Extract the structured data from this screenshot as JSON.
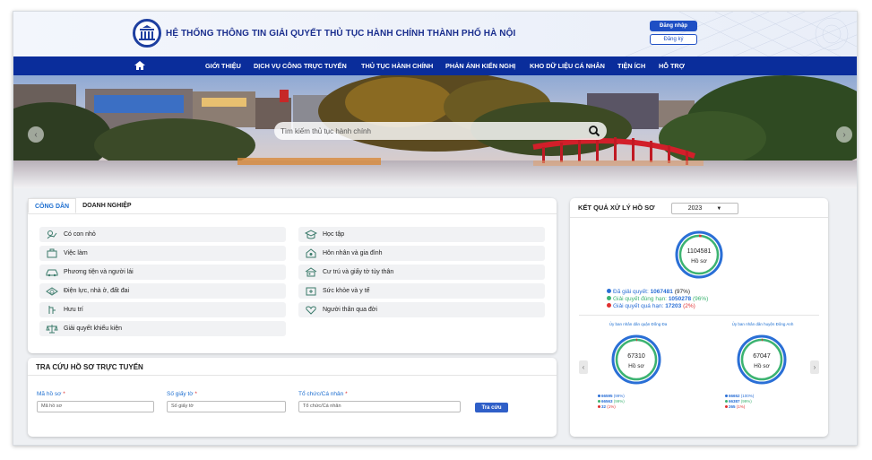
{
  "header": {
    "title": "HỆ THỐNG THÔNG TIN GIẢI QUYẾT THỦ TỤC HÀNH CHÍNH THÀNH PHỐ HÀ NỘI",
    "login_label": "Đăng nhập",
    "register_label": "Đăng ký"
  },
  "nav": {
    "items": [
      "GIỚI THIỆU",
      "DỊCH VỤ CÔNG TRỰC TUYẾN",
      "THỦ TỤC HÀNH CHÍNH",
      "PHẢN ÁNH KIẾN NGHỊ",
      "KHO DỮ LIỆU CÁ NHÂN",
      "TIỆN ÍCH",
      "HỖ TRỢ"
    ]
  },
  "banner": {
    "search_placeholder": "Tìm kiếm thủ tục hành chính"
  },
  "services": {
    "tabs": [
      "CÔNG DÂN",
      "DOANH NGHIỆP"
    ],
    "left": [
      {
        "label": "Có con nhỏ",
        "icon": "baby-icon"
      },
      {
        "label": "Việc làm",
        "icon": "briefcase-icon"
      },
      {
        "label": "Phương tiện và người lái",
        "icon": "car-icon"
      },
      {
        "label": "Điện lực, nhà ở, đất đai",
        "icon": "land-icon"
      },
      {
        "label": "Hưu trí",
        "icon": "retire-icon"
      },
      {
        "label": "Giải quyết khiếu kiện",
        "icon": "scale-icon"
      }
    ],
    "right": [
      {
        "label": "Học tập",
        "icon": "graduation-icon"
      },
      {
        "label": "Hôn nhân và gia đình",
        "icon": "family-icon"
      },
      {
        "label": "Cư trú và giấy tờ tùy thân",
        "icon": "id-card-icon"
      },
      {
        "label": "Sức khỏe và y tế",
        "icon": "health-icon"
      },
      {
        "label": "Người thân qua đời",
        "icon": "heart-icon"
      }
    ]
  },
  "lookup": {
    "title": "TRA CỨU HỒ SƠ TRỰC TUYẾN",
    "field1_label": "Mã hồ sơ",
    "field1_placeholder": "Mã hồ sơ",
    "field2_label": "Số giấy tờ",
    "field2_placeholder": "Số giấy tờ",
    "field3_label": "Tổ chức/Cá nhân",
    "field3_placeholder": "Tổ chức/Cá nhân",
    "required_mark": "*",
    "button_label": "Tra cứu"
  },
  "results": {
    "title": "KẾT QUẢ XỬ LÝ HỒ SƠ",
    "year": "2023",
    "total": "1104581",
    "unit": "Hồ sơ",
    "legend": [
      {
        "label": "Đã giải quyết:",
        "value": "1067481",
        "pct": "(97%)",
        "color": "#2a6fd6"
      },
      {
        "label": "Giải quyết đúng hạn:",
        "value": "1050278",
        "pct": "(96%)",
        "color": "#3cb371"
      },
      {
        "label": "Giải quyết quá hạn:",
        "value": "17203",
        "pct": "(2%)",
        "color": "#e03030"
      }
    ],
    "sub": [
      {
        "title": "Ủy ban nhân dân quận Đống Đa",
        "total": "67310",
        "unit": "Hồ sơ",
        "legend": [
          {
            "value": "66595",
            "pct": "(99%)",
            "color": "#2a6fd6"
          },
          {
            "value": "66563",
            "pct": "(99%)",
            "color": "#3cb371"
          },
          {
            "value": "32",
            "pct": "(1%)",
            "color": "#e03030"
          }
        ]
      },
      {
        "title": "Ủy ban nhân dân huyện Đông Anh",
        "total": "67047",
        "unit": "Hồ sơ",
        "legend": [
          {
            "value": "66652",
            "pct": "(100%)",
            "color": "#2a6fd6"
          },
          {
            "value": "66387",
            "pct": "(99%)",
            "color": "#3cb371"
          },
          {
            "value": "265",
            "pct": "(1%)",
            "color": "#e03030"
          }
        ]
      }
    ]
  },
  "colors": {
    "nav_bg": "#0a2d9b",
    "title_blue": "#1b2f8e",
    "accent_blue": "#1e6fd0",
    "ring_blue": "#2a6fd6",
    "ring_green": "#3cb371",
    "ring_red": "#e03030"
  }
}
